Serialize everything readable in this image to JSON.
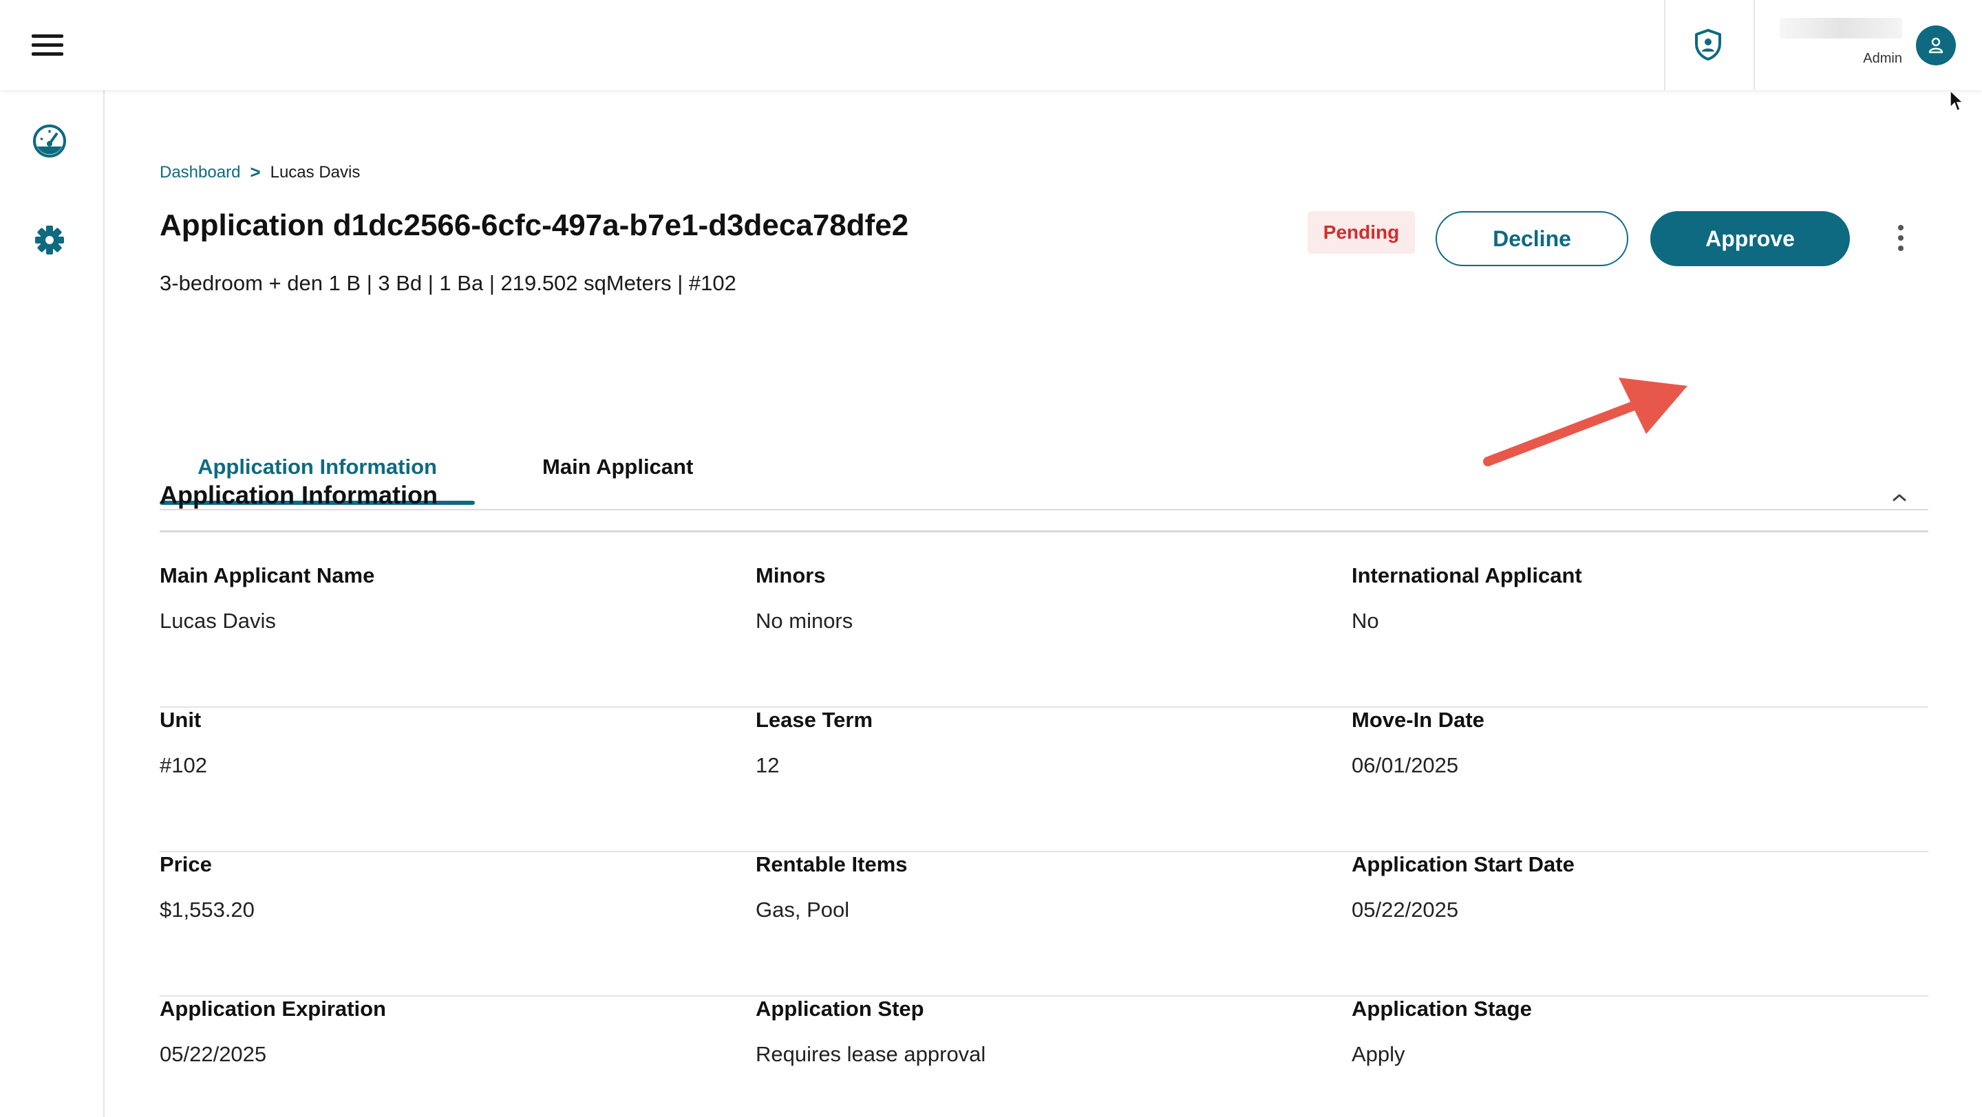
{
  "header": {
    "user_role": "Admin",
    "icons": {
      "menu": "hamburger-menu-icon",
      "shield": "shield-user-icon",
      "avatar": "user-icon"
    }
  },
  "sidebar": {
    "items": [
      {
        "name": "dashboard",
        "icon": "gauge-icon"
      },
      {
        "name": "settings",
        "icon": "gear-icon"
      }
    ]
  },
  "breadcrumb": {
    "root": "Dashboard",
    "separator": ">",
    "current": "Lucas Davis"
  },
  "page": {
    "title": "Application d1dc2566-6cfc-497a-b7e1-d3deca78dfe2",
    "subtitle": "3-bedroom + den 1 B | 3 Bd | 1 Ba | 219.502 sqMeters | #102",
    "status": "Pending",
    "decline_label": "Decline",
    "approve_label": "Approve"
  },
  "tabs": [
    {
      "label": "Application Information",
      "active": true
    },
    {
      "label": "Main Applicant",
      "active": false
    }
  ],
  "section": {
    "title": "Application Information",
    "rows": [
      [
        {
          "label": "Main Applicant Name",
          "value": "Lucas Davis"
        },
        {
          "label": "Minors",
          "value": "No minors"
        },
        {
          "label": "International Applicant",
          "value": "No"
        }
      ],
      [
        {
          "label": "Unit",
          "value": "#102"
        },
        {
          "label": "Lease Term",
          "value": "12"
        },
        {
          "label": "Move-In Date",
          "value": "06/01/2025"
        }
      ],
      [
        {
          "label": "Price",
          "value": "$1,553.20"
        },
        {
          "label": "Rentable Items",
          "value": "Gas, Pool"
        },
        {
          "label": "Application Start Date",
          "value": "05/22/2025"
        }
      ],
      [
        {
          "label": "Application Expiration",
          "value": "05/22/2025"
        },
        {
          "label": "Application Step",
          "value": "Requires lease approval"
        },
        {
          "label": "Application Stage",
          "value": "Apply"
        }
      ]
    ]
  },
  "colors": {
    "accent": "#0d6a80",
    "pending_bg": "#fcebeb",
    "pending_text": "#cf2e2e",
    "annotation_arrow": "#e8584a"
  }
}
